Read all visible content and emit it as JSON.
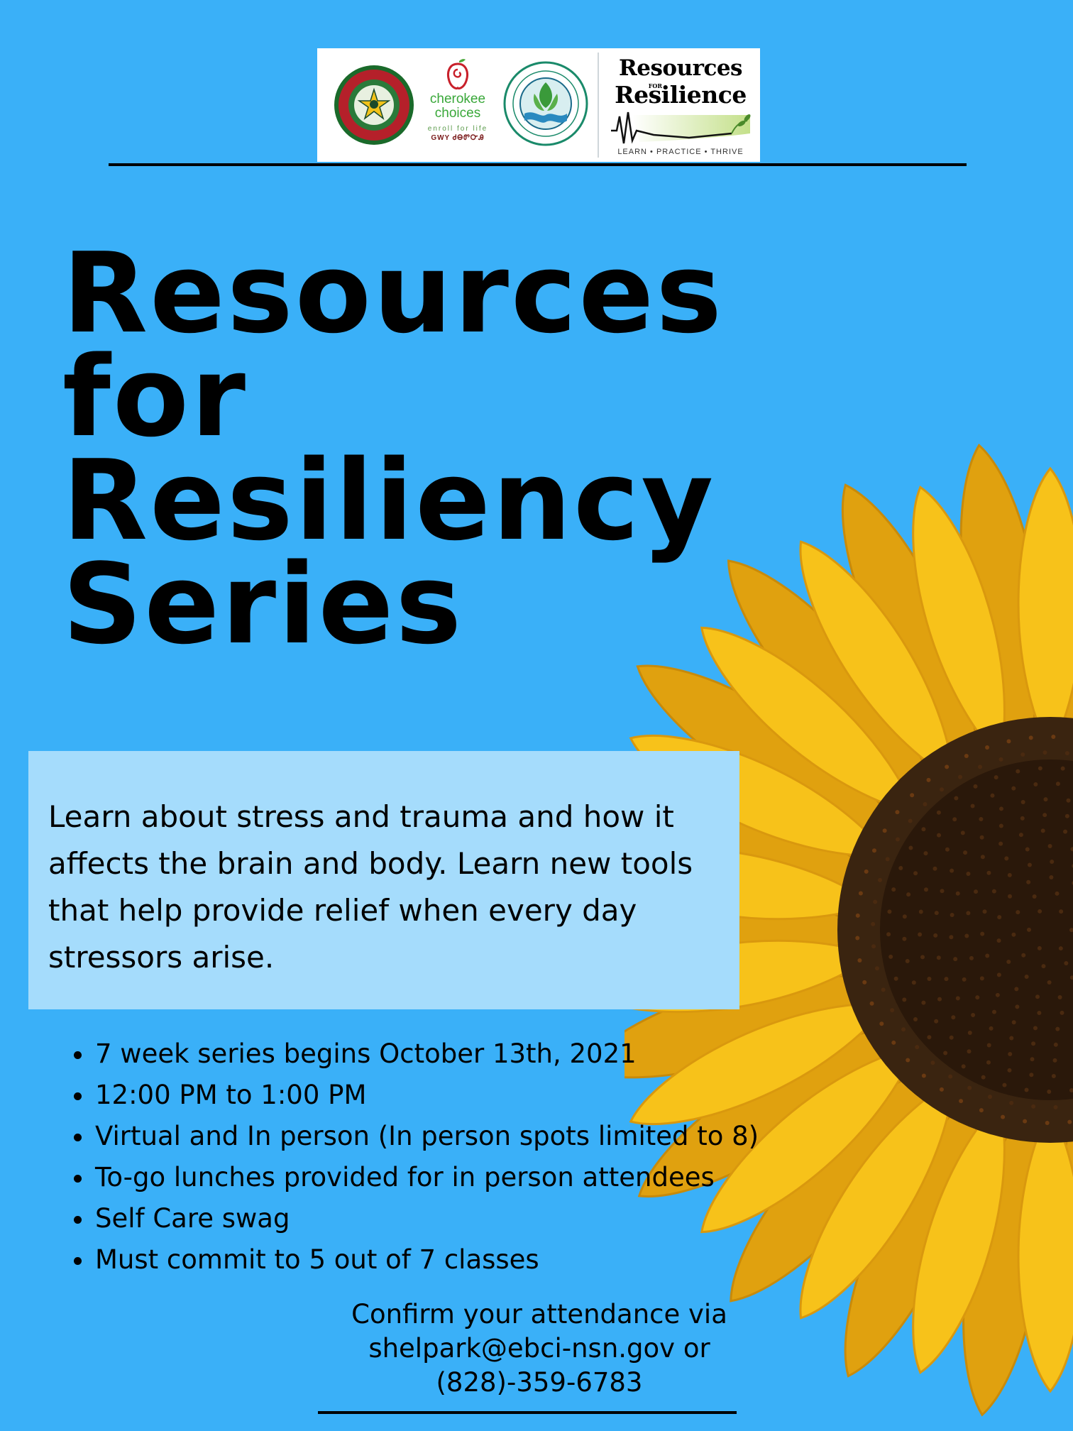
{
  "logos": {
    "cherokee_choices": {
      "brand_line1": "cherokee",
      "brand_line2": "choices",
      "tagline": "enroll for life",
      "syllabary": "GWY ᏧᎾᏛᏅᎯ"
    },
    "resources_for_resilience": {
      "line1": "Resources",
      "for": "FOR",
      "line2": "Resilience",
      "tagline": "LEARN • PRACTICE • THRIVE"
    }
  },
  "title": {
    "line1": "Resources",
    "line2": "for",
    "line3": "Resiliency",
    "line4": "Series"
  },
  "description": "Learn about stress and trauma and how it affects the brain and body. Learn new tools that help provide relief when every day stressors arise.",
  "details": [
    "7 week series begins October 13th, 2021",
    "12:00 PM to 1:00 PM",
    "Virtual and In person (In person spots limited to 8)",
    "To-go lunches provided for in person attendees",
    "Self Care swag",
    "Must commit to 5 out of 7 classes"
  ],
  "contact": {
    "line1": "Confirm your attendance via",
    "line2": "shelpark@ebci-nsn.gov or",
    "line3": "(828)-359-6783"
  },
  "colors": {
    "background": "#3ab0f8",
    "description_box": "#a5dcfc",
    "petal": "#f7c21a",
    "petal_shadow": "#e0a10f",
    "flower_center": "#3a2410"
  }
}
